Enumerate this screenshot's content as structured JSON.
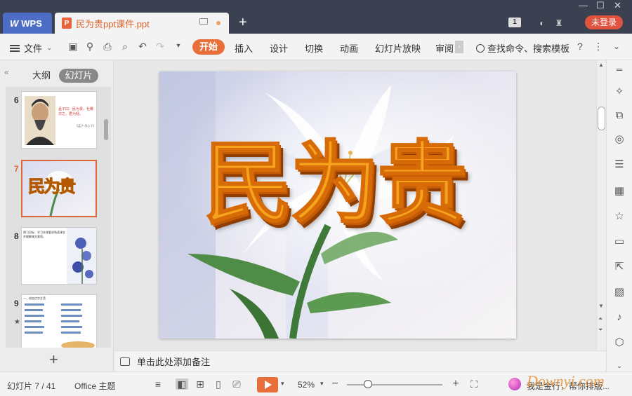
{
  "titlebar": {
    "app_tab": "WPS",
    "doc_tab": "民为贵ppt课件.ppt",
    "badge": "1",
    "login": "未登录"
  },
  "menubar": {
    "file": "文件",
    "start": "开始",
    "items": [
      "插入",
      "设计",
      "切换",
      "动画",
      "幻灯片放映",
      "审阅"
    ],
    "search": "查找命令、搜索模板",
    "help": "?"
  },
  "leftpanel": {
    "tab_outline": "大纲",
    "tab_slides": "幻灯片",
    "slides": [
      {
        "num": "6",
        "text": "孟子曰：民为贵，社稷次之，君为轻。",
        "cite": "《孟子·尽心下》"
      },
      {
        "num": "7",
        "title": "民为贵"
      },
      {
        "num": "8",
        "text": "预习目标：学习本课要求熟读课文并理解课文意思。"
      },
      {
        "num": "9",
        "text": "一、给加点字注音"
      }
    ]
  },
  "slide": {
    "title": "民为贵"
  },
  "notes": {
    "placeholder": "单击此处添加备注"
  },
  "statusbar": {
    "slide_info": "幻灯片 7 / 41",
    "theme": "Office 主题",
    "zoom": "52%",
    "zoom_fraction": 0.22,
    "message": "我是金行，帮你排版...",
    "watermark": "Downyi.com"
  }
}
